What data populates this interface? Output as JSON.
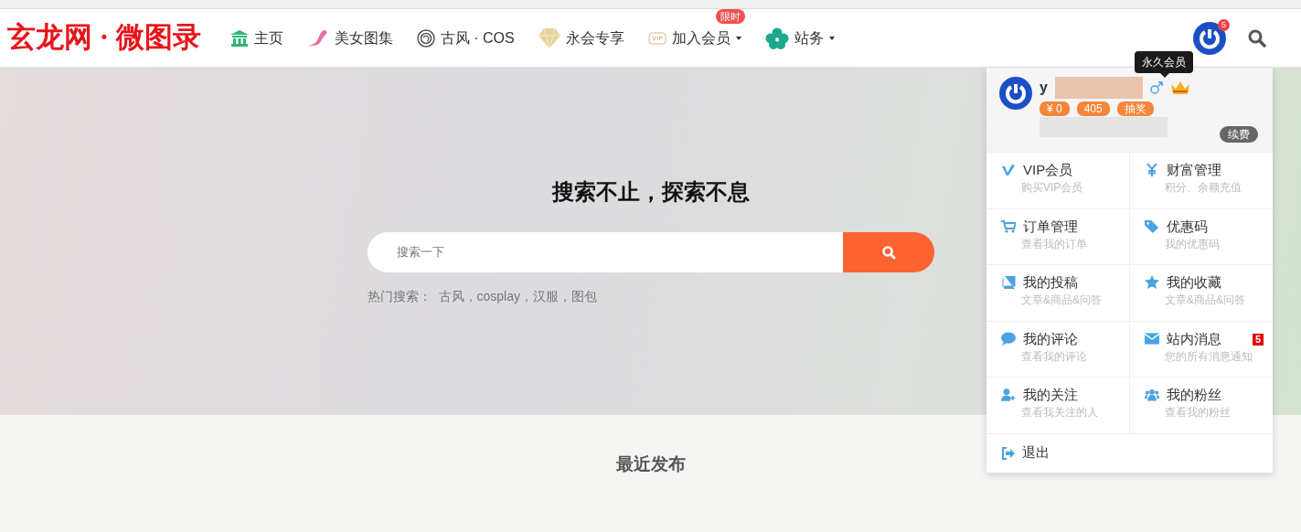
{
  "logo": "玄龙网 · 微图录",
  "nav": [
    {
      "label": "主页",
      "caret": false
    },
    {
      "label": "美女图集",
      "caret": false
    },
    {
      "label": "古风 · COS",
      "caret": false
    },
    {
      "label": "永会专享",
      "caret": false
    },
    {
      "label": "加入会员",
      "caret": true,
      "badge": "限时"
    },
    {
      "label": "站务",
      "caret": true
    }
  ],
  "user": {
    "notification_count": "5",
    "tooltip": "永久会员",
    "name": "y",
    "chips": [
      "¥ 0",
      "405",
      "抽奖"
    ],
    "renew": "续费"
  },
  "hero": {
    "title": "搜索不止，探索不息",
    "search": {
      "placeholder": "搜索一下"
    },
    "hot_label": "热门搜索：",
    "hot_terms": "古风，cosplay，汉服，图包"
  },
  "recent_title": "最近发布",
  "menu": [
    {
      "title": "VIP会员",
      "subtitle": "购买VIP会员"
    },
    {
      "title": "财富管理",
      "subtitle": "积分、余额充值"
    },
    {
      "title": "订单管理",
      "subtitle": "查看我的订单"
    },
    {
      "title": "优惠码",
      "subtitle": "我的优惠码"
    },
    {
      "title": "我的投稿",
      "subtitle": "文章&商品&问答"
    },
    {
      "title": "我的收藏",
      "subtitle": "文章&商品&问答"
    },
    {
      "title": "我的评论",
      "subtitle": "查看我的评论"
    },
    {
      "title": "站内消息",
      "subtitle": "您的所有消息通知",
      "badge": "5"
    },
    {
      "title": "我的关注",
      "subtitle": "查看我关注的人"
    },
    {
      "title": "我的粉丝",
      "subtitle": "查看我的粉丝"
    }
  ],
  "logout": "退出"
}
